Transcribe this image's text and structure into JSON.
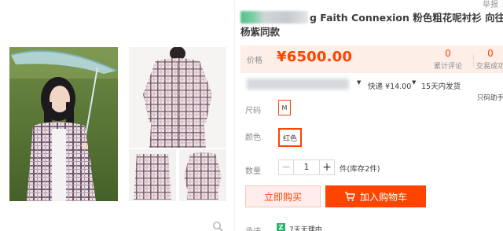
{
  "header": {
    "top_link": "举报",
    "title_line1": "g Faith Connexion 粉色粗花呢衬衫 向往的生活",
    "title_line2": "杨紫同款"
  },
  "price": {
    "label": "价格",
    "value": "¥6500.00",
    "comments_count": "0",
    "comments_label": "累计评论",
    "deals_count": "0",
    "deals_label": "交易成功"
  },
  "shipping": {
    "arrow": "▼",
    "method": "快递 ¥14.00",
    "time": "15天内发货",
    "note": "只码助手"
  },
  "options": {
    "size_label": "尺码",
    "size_value": "M",
    "color_label": "颜色",
    "color_value": "红色"
  },
  "quantity": {
    "label": "数量",
    "minus": "−",
    "value": "1",
    "plus": "+",
    "stock": "件(库存2件)"
  },
  "actions": {
    "buy_now": "立即购买",
    "add_to_cart": "加入购物车"
  },
  "delivery": {
    "label": "承诺",
    "badge": "Z",
    "text": "7天无理由"
  },
  "colors": {
    "accent": "#ff4400",
    "price_bg": "#fdeee7",
    "buy_bg": "#ffeded"
  },
  "icons": {
    "zoom": "magnifier-icon",
    "cart": "cart-icon"
  }
}
